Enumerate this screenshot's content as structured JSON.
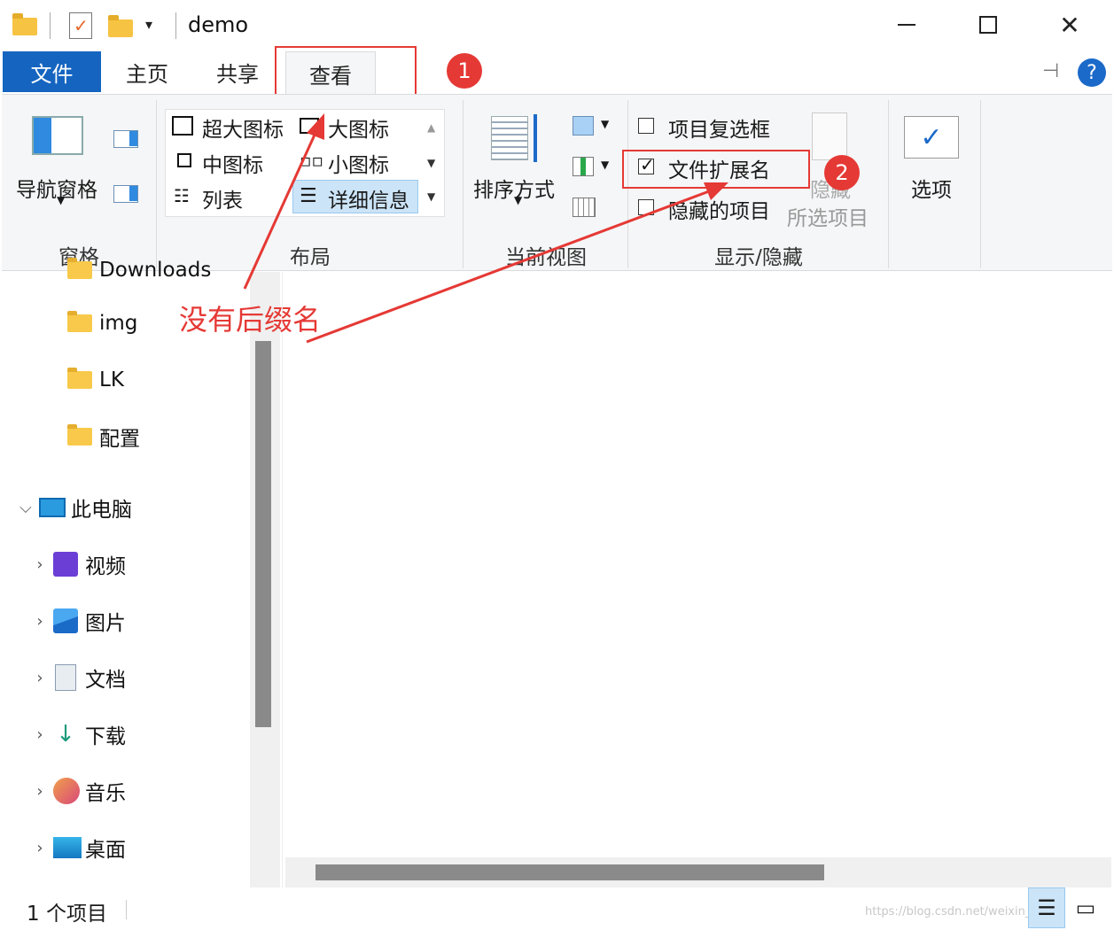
{
  "window": {
    "title": "demo"
  },
  "tabs": [
    {
      "label": "文件"
    },
    {
      "label": "主页"
    },
    {
      "label": "共享"
    },
    {
      "label": "查看"
    }
  ],
  "ribbon": {
    "panes": {
      "nav_pane": "导航窗格",
      "label": "窗格"
    },
    "layout": {
      "items": [
        "超大图标",
        "大图标",
        "中图标",
        "小图标",
        "列表",
        "详细信息"
      ],
      "label": "布局"
    },
    "current_view": {
      "sort_by": "排序方式",
      "label": "当前视图"
    },
    "show_hide": {
      "item_checkboxes": "项目复选框",
      "file_extensions": "文件扩展名",
      "hidden_items": "隐藏的项目",
      "hide_selected_line1": "隐藏",
      "hide_selected_line2": "所选项目",
      "label": "显示/隐藏",
      "file_extensions_checked": true,
      "item_checkboxes_checked": false,
      "hidden_items_checked": false
    },
    "options": {
      "label": "选项"
    }
  },
  "annotations": {
    "badge1": "1",
    "badge2": "2",
    "note": "没有后缀名",
    "color": "#e53935"
  },
  "nav": {
    "partial_item": "Downloads",
    "folders": [
      "img",
      "LK",
      "配置"
    ],
    "this_pc": "此电脑",
    "pc_items": [
      "视频",
      "图片",
      "文档",
      "下载",
      "音乐",
      "桌面"
    ]
  },
  "status": {
    "count": "1 个项目"
  },
  "watermark": "https://blog.csdn.net/weixin_..."
}
